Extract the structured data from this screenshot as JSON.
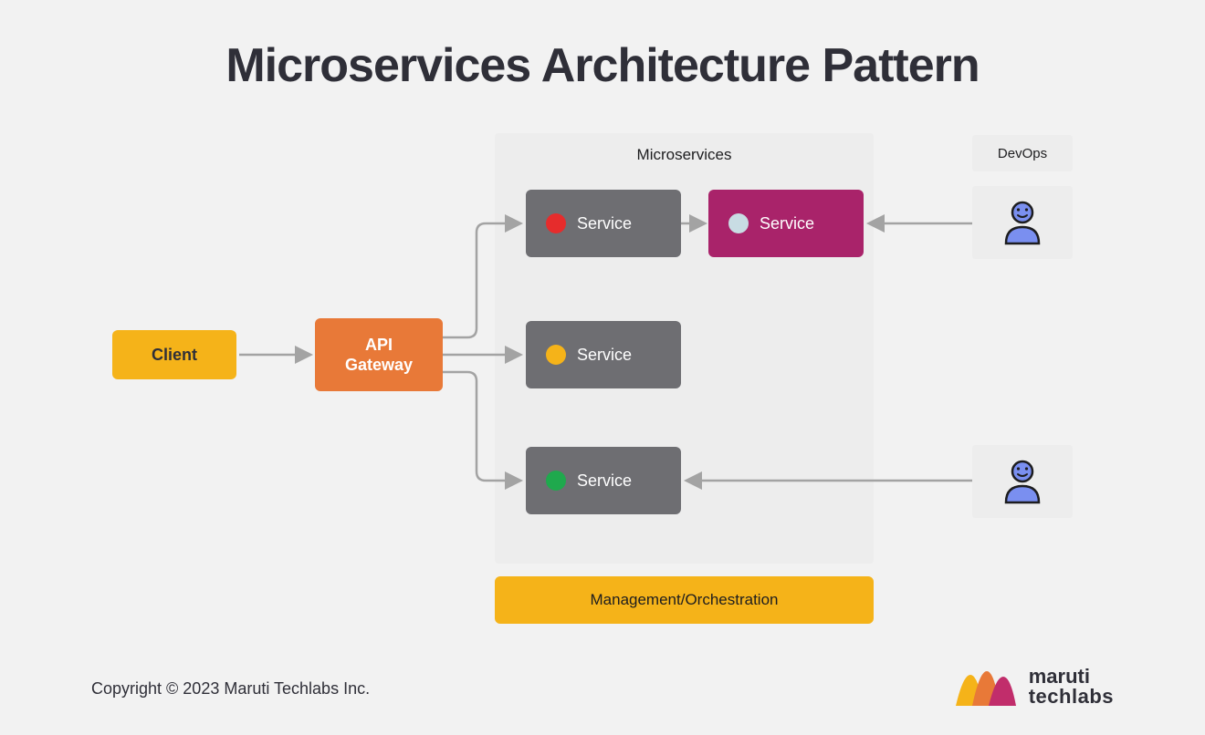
{
  "title": "Microservices Architecture Pattern",
  "client": {
    "label": "Client"
  },
  "gateway": {
    "label": "API\nGateway"
  },
  "microservices": {
    "heading": "Microservices",
    "services": [
      {
        "label": "Service",
        "dot_color": "#e62c2c"
      },
      {
        "label": "Service",
        "dot_color": "#f5b319"
      },
      {
        "label": "Service",
        "dot_color": "#1fa94d"
      },
      {
        "label": "Service",
        "dot_color": "#c8dce3",
        "bg": "#a9236a"
      }
    ]
  },
  "management": {
    "label": "Management/Orchestration"
  },
  "devops": {
    "label": "DevOps"
  },
  "footer": {
    "copyright": "Copyright © 2023 Maruti Techlabs Inc.",
    "brand_line1": "maruti",
    "brand_line2": "techlabs"
  },
  "colors": {
    "yellow": "#f5b319",
    "orange": "#e87938",
    "grey_box": "#6e6e72",
    "magenta": "#a9236a",
    "arrow": "#a3a3a3",
    "user_fill": "#7a8ff0",
    "user_stroke": "#1d1d1f"
  }
}
